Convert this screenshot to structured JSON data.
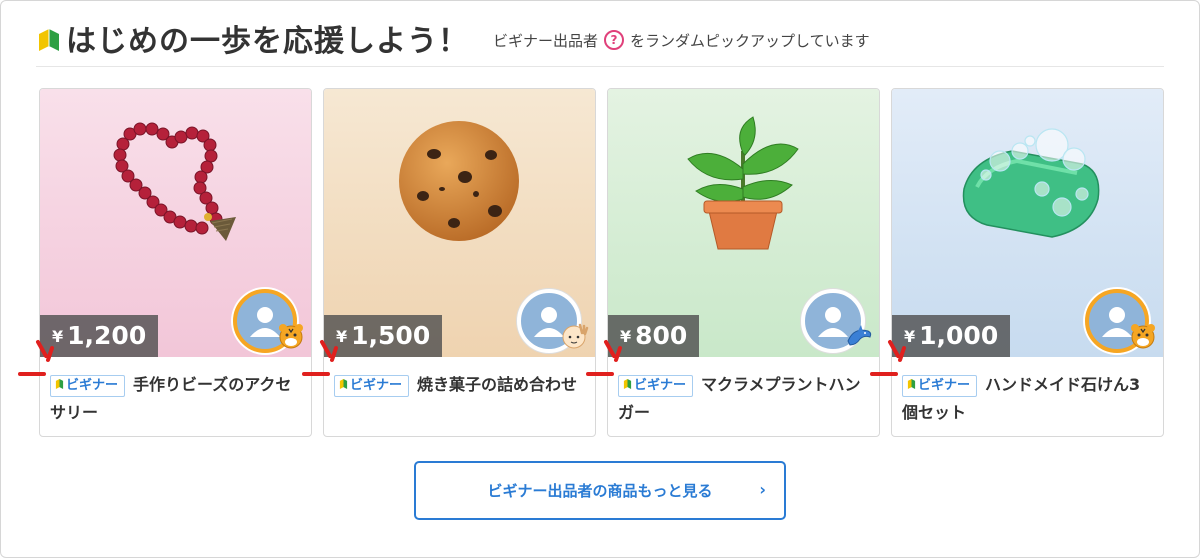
{
  "header": {
    "title": "はじめの一歩を応援しよう！",
    "subtitle_before": "ビギナー出品者",
    "help_icon": "help-circle-icon",
    "help_glyph": "?",
    "subtitle_after": "をランダムピックアップしています"
  },
  "cards": [
    {
      "price_symbol": "¥",
      "price": "1,200",
      "tag": "ビギナー",
      "title": "手作りビーズのアクセサリー",
      "image": "bead-necklace-illustration",
      "badge": "tiger-emoji",
      "bg_top": "#f9e0ea",
      "bg_bottom": "#f2c6d8"
    },
    {
      "price_symbol": "¥",
      "price": "1,500",
      "tag": "ビギナー",
      "title": "焼き菓子の詰め合わせ",
      "image": "cookie-illustration",
      "badge": "baby-hand-emoji",
      "bg_top": "#f6e8d3",
      "bg_bottom": "#efd3b0"
    },
    {
      "price_symbol": "¥",
      "price": "800",
      "tag": "ビギナー",
      "title": "マクラメプラントハンガー",
      "image": "potted-plant-illustration",
      "badge": "dolphin-emoji",
      "bg_top": "#e4f3e2",
      "bg_bottom": "#c9e8c9"
    },
    {
      "price_symbol": "¥",
      "price": "1,000",
      "tag": "ビギナー",
      "title": "ハンドメイド石けん3個セット",
      "image": "soap-illustration",
      "badge": "tiger-emoji",
      "bg_top": "#e2ecf8",
      "bg_bottom": "#c7dbef"
    }
  ],
  "more_button": {
    "label": "ビギナー出品者の商品もっと見る",
    "icon": "chevron-right-icon",
    "glyph": "›"
  },
  "colors": {
    "accent": "#2a7bd4",
    "help": "#e0407a",
    "price_bg": "#505050",
    "spark": "#e0201e"
  }
}
